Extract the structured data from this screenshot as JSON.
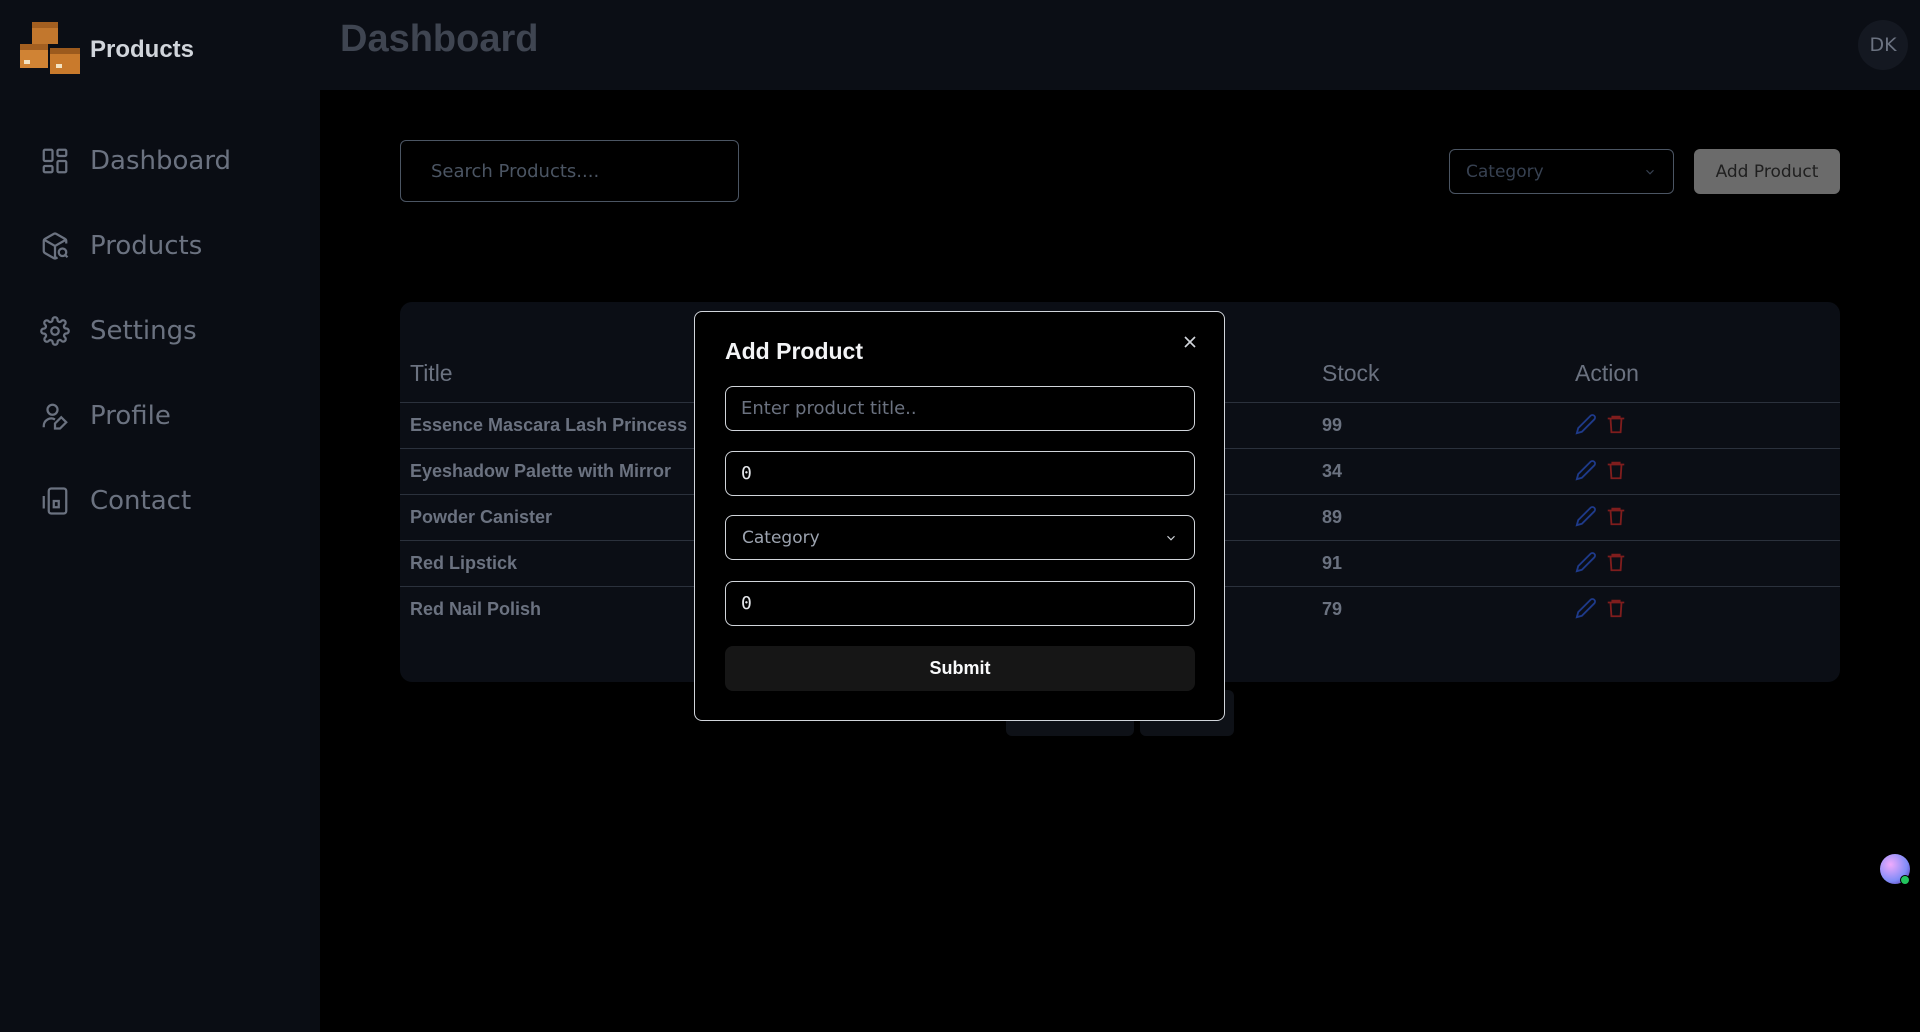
{
  "brand": {
    "name": "Products",
    "logo_icon": "boxes-logo-icon"
  },
  "sidebar": {
    "items": [
      {
        "label": "Dashboard",
        "icon": "dashboard-grid-icon"
      },
      {
        "label": "Products",
        "icon": "package-search-icon"
      },
      {
        "label": "Settings",
        "icon": "gear-icon"
      },
      {
        "label": "Profile",
        "icon": "user-pen-icon"
      },
      {
        "label": "Contact",
        "icon": "phone-device-icon"
      }
    ]
  },
  "header": {
    "title": "Dashboard",
    "avatar_initials": "DK"
  },
  "toolbar": {
    "search_placeholder": "Search Products....",
    "category_placeholder": "Category",
    "add_label": "Add Product"
  },
  "table": {
    "headers": {
      "title": "Title",
      "stock": "Stock",
      "action": "Action"
    },
    "rows": [
      {
        "title": "Essence Mascara Lash Princess",
        "stock": "99"
      },
      {
        "title": "Eyeshadow Palette with Mirror",
        "stock": "34"
      },
      {
        "title": "Powder Canister",
        "stock": "89"
      },
      {
        "title": "Red Lipstick",
        "stock": "91"
      },
      {
        "title": "Red Nail Polish",
        "stock": "79"
      }
    ]
  },
  "modal": {
    "title": "Add Product",
    "title_placeholder": "Enter product title..",
    "price_value": "0",
    "category_placeholder": "Category",
    "stock_value": "0",
    "submit_label": "Submit"
  },
  "colors": {
    "background": "#000000",
    "sidebar": "#0a0d14",
    "edit_icon": "#1e3a8a",
    "delete_icon": "#7f1d1d",
    "modal_border": "#d1d5db"
  }
}
